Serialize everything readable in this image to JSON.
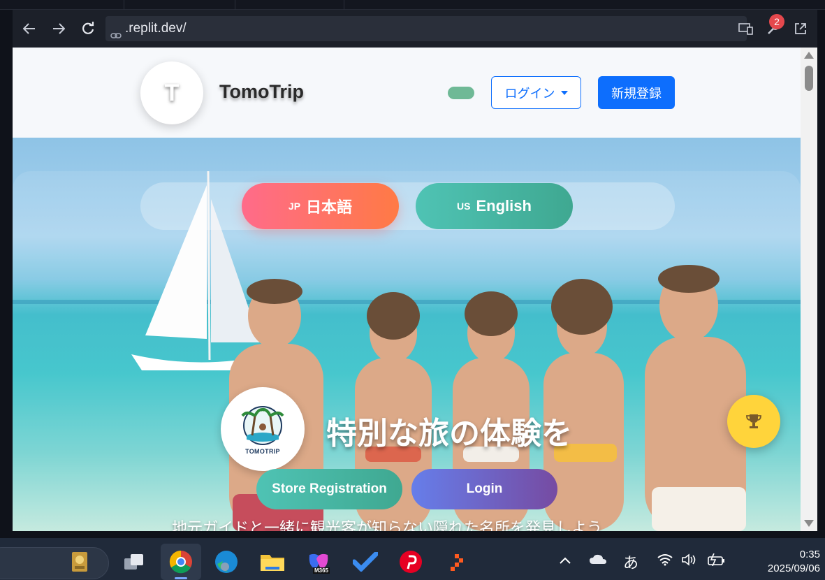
{
  "browser": {
    "url": ".replit.dev/",
    "badge_count": "2",
    "icons": [
      "back-arrow-icon",
      "forward-arrow-icon",
      "reload-icon",
      "link-icon",
      "devices-icon",
      "wrench-icon",
      "open-external-icon"
    ]
  },
  "site_header": {
    "logo_letter": "T",
    "brand": "TomoTrip",
    "login_label": "ログイン",
    "signup_label": "新規登録"
  },
  "hero": {
    "lang_jp_code": "JP",
    "lang_jp_label": "日本語",
    "lang_en_code": "US",
    "lang_en_label": "English",
    "badge_logo_text": "TOMOTRIP",
    "title": "特別な旅の体験を",
    "store_registration": "Store Registration",
    "login": "Login",
    "subtitle": "地元ガイドと一緒に観光客が知らない隠れた名所を発見しよう"
  },
  "taskbar": {
    "ime": "あ",
    "time": "0:35",
    "date": "2025/09/06",
    "m365_label": "M365"
  },
  "colors": {
    "primary": "#0d6efd",
    "toggle": "#6fb996",
    "trophy": "#ffd43b"
  }
}
